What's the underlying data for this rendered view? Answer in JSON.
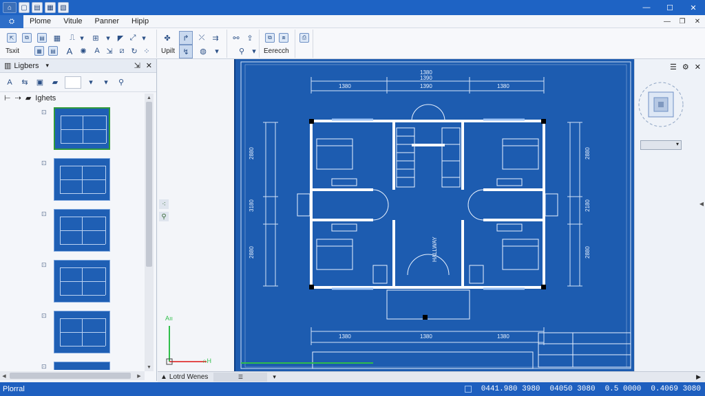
{
  "quick_access": {
    "buttons": [
      "app-menu",
      "new",
      "open",
      "save",
      "save-as"
    ]
  },
  "menubar": {
    "file_label": "⛭",
    "items": [
      "Plome",
      "Vitule",
      "Panner",
      "Hipip"
    ]
  },
  "ribbon": {
    "labels": {
      "text": "Tsxit",
      "hint": "Upilt",
      "search": "Eerecch"
    }
  },
  "left_panel": {
    "title": "Ligbers",
    "root_label": "Ighets",
    "pages": [
      "page-1",
      "page-2",
      "page-3",
      "page-4",
      "page-5",
      "page-6"
    ]
  },
  "drawing": {
    "top_dims": [
      "1380",
      "1390",
      "1380",
      "1380",
      "1390"
    ],
    "bottom_dims": [
      "1380",
      "1380",
      "1380"
    ],
    "left_dims": [
      "2880",
      "3180",
      "2880"
    ],
    "right_dims": [
      "2880",
      "2180",
      "2880"
    ],
    "hall_label": "HALLWAY"
  },
  "ucs": {
    "y_label": "Aıı",
    "x_label": "∩H"
  },
  "canvas_tabs": {
    "tab_label": "Lotrd Wenes",
    "tab_box": "☰"
  },
  "statusbar": {
    "label": "Plorral",
    "coords": [
      "0441.980 3980",
      "04050 3080",
      "0.5 0000",
      "0.4069 3080"
    ]
  },
  "colors": {
    "titlebar": "#1e63c4",
    "sheet": "#1d5cb0",
    "lines": "#e9f2ff"
  }
}
